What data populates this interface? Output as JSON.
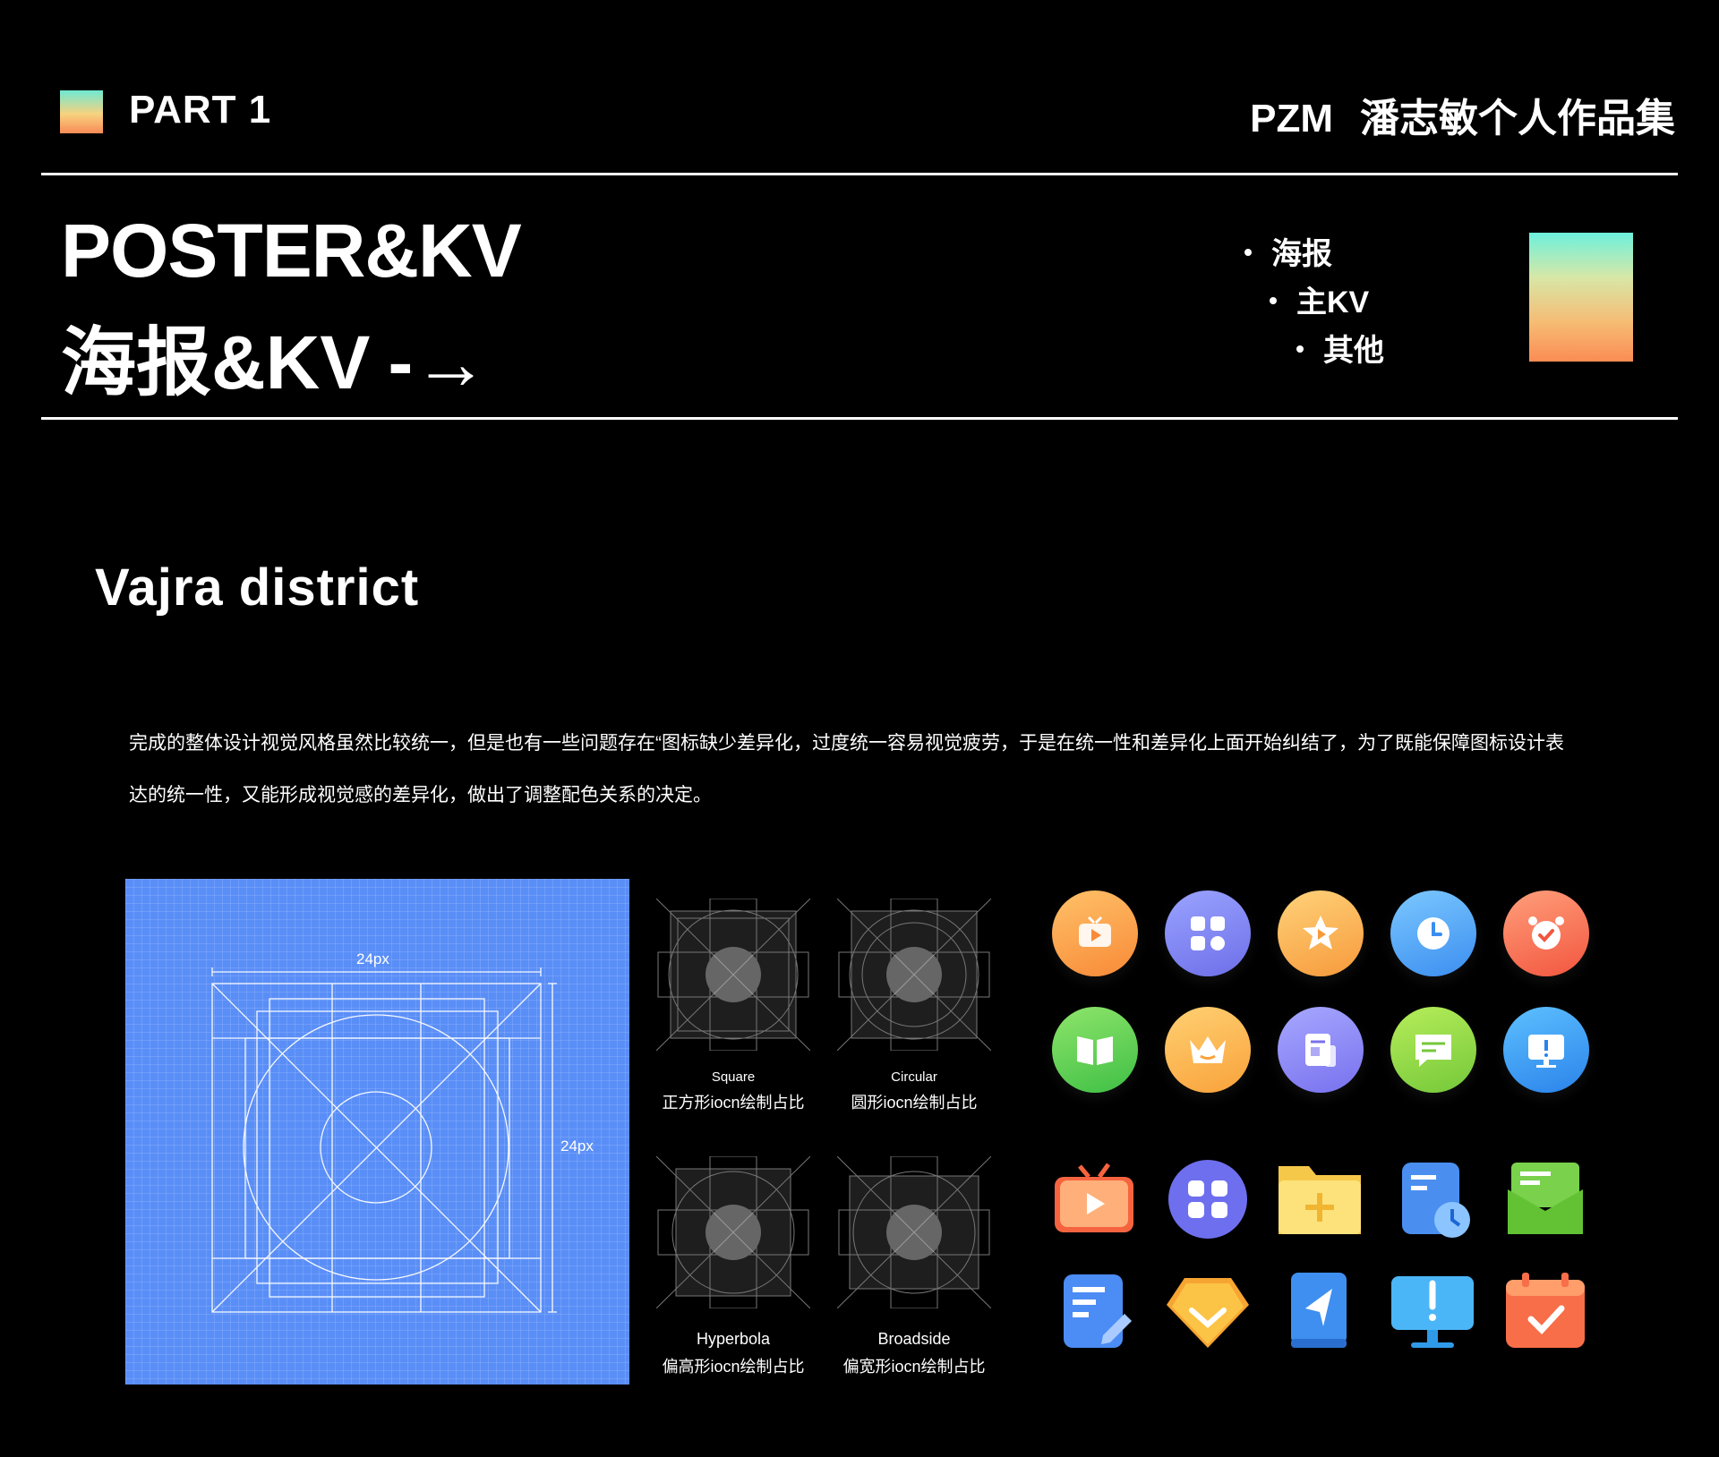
{
  "header": {
    "part_label": "PART 1",
    "brand_code": "PZM",
    "brand_title": "潘志敏个人作品集"
  },
  "hero": {
    "title_en": "POSTER&KV",
    "title_cn": "海报&KV",
    "arrow": "-→"
  },
  "bullets": [
    "海报",
    "主KV",
    "其他"
  ],
  "section": {
    "title": "Vajra district",
    "paragraph_line1": "完成的整体设计视觉风格虽然比较统一，但是也有一些问题存在“图标缺少差异化，过度统一容易视觉疲劳，于是在统一性和差异化上面开始纠结了，为了既能保障图标设计表",
    "paragraph_line2": "达的统一性，又能形成视觉感的差异化，做出了调整配色关系的决定。"
  },
  "blueprint": {
    "width_label": "24px",
    "height_label": "24px"
  },
  "grids": [
    {
      "en": "Square",
      "cn": "正方形iocn绘制占比"
    },
    {
      "en": "Circular",
      "cn": "圆形iocn绘制占比"
    },
    {
      "en": "Hyperbola",
      "cn": "偏高形iocn绘制占比"
    },
    {
      "en": "Broadside",
      "cn": "偏宽形iocn绘制占比"
    }
  ],
  "colors": {
    "orange": "#f89a42",
    "purple": "#7b7ff0",
    "yellow": "#f7b34a",
    "blue": "#4fa9f5",
    "coral": "#f7705a",
    "green": "#5fcf4d",
    "lime": "#8fd63f",
    "sky": "#2f9ef0"
  },
  "icons_round": [
    "tv-icon",
    "apps-grid-icon",
    "star-icon",
    "clock-icon",
    "alarm-clock-icon",
    "book-icon",
    "crown-icon",
    "document-icon",
    "chat-icon",
    "monitor-alert-icon"
  ],
  "icons_shape": [
    "tv-icon",
    "apps-grid-icon",
    "folder-add-icon",
    "schedule-icon",
    "mail-icon",
    "note-edit-icon",
    "diamond-icon",
    "navigation-icon",
    "monitor-alert-icon",
    "calendar-check-icon"
  ]
}
